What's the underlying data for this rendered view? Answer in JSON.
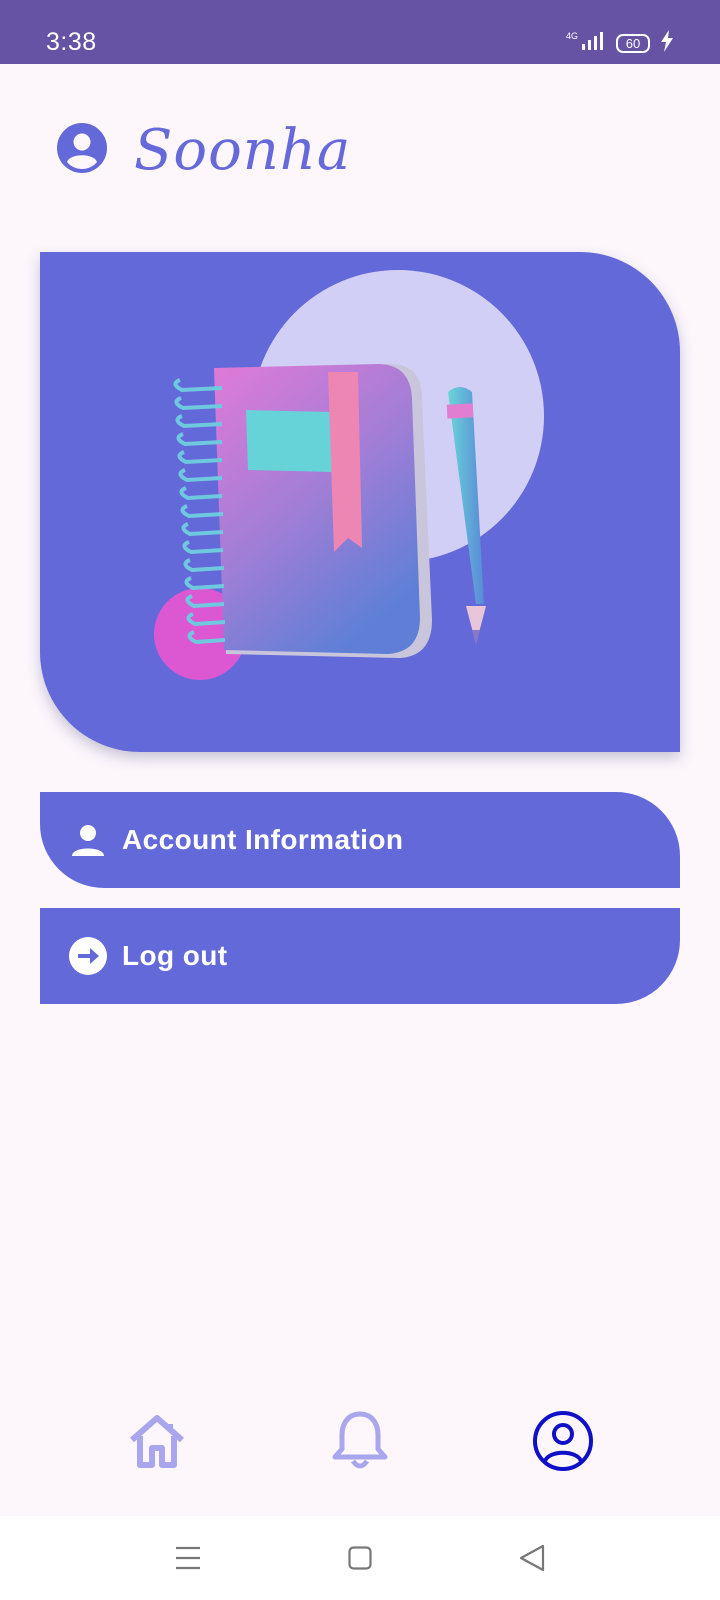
{
  "status_bar": {
    "time": "3:38",
    "network": "4G",
    "battery": "60",
    "icons": [
      "data-arrows-icon",
      "signal-icon",
      "battery-icon",
      "charging-bolt-icon"
    ]
  },
  "header": {
    "icon": "user-circle-icon",
    "name": "Soonha"
  },
  "banner": {
    "illustration": "notebook-and-pencil-illustration"
  },
  "menu": {
    "account": {
      "icon": "person-icon",
      "label": "Account Information"
    },
    "logout": {
      "icon": "logout-arrow-icon",
      "label": "Log out"
    }
  },
  "bottom_nav": {
    "items": [
      {
        "icon": "home-icon",
        "active": false
      },
      {
        "icon": "bell-icon",
        "active": false
      },
      {
        "icon": "profile-icon",
        "active": true
      }
    ]
  },
  "system_nav": {
    "buttons": [
      "menu-lines-icon",
      "home-square-icon",
      "back-triangle-icon"
    ]
  },
  "colors": {
    "status_bar": "#6653a3",
    "accent": "#6469da",
    "background": "#fdf7fc",
    "nav_inactive": "#a9a6ee",
    "nav_active": "#1010c8"
  }
}
